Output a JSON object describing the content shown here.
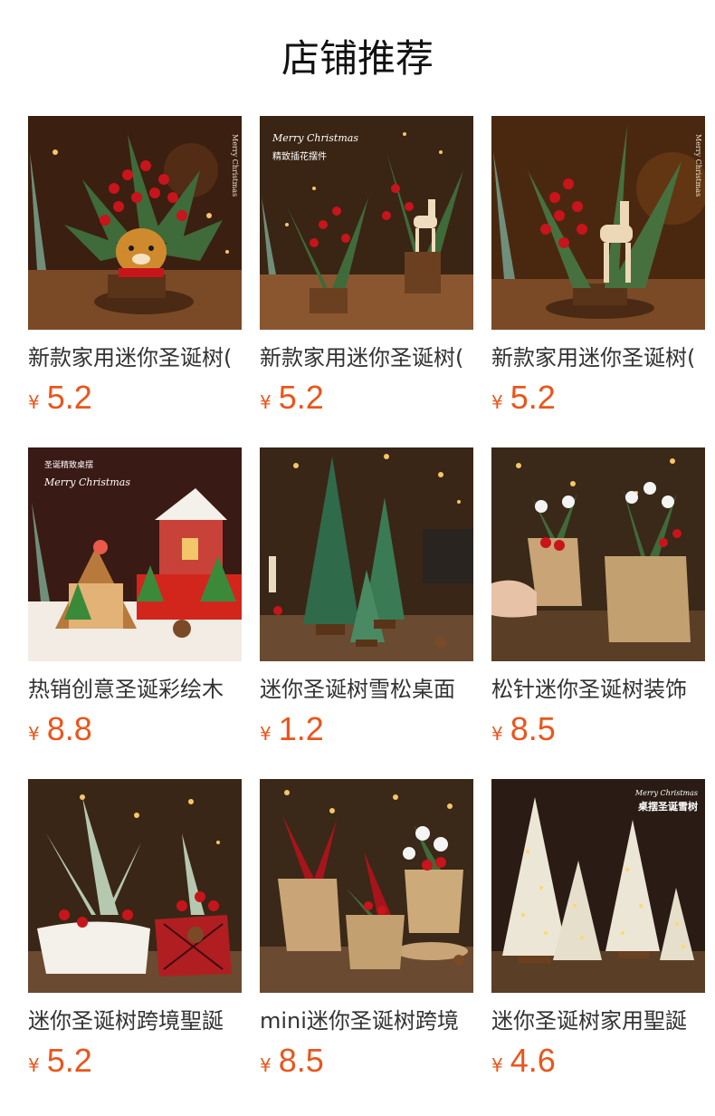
{
  "page": {
    "title": "店铺推荐"
  },
  "colors": {
    "price": "#e9561b",
    "text": "#333333",
    "title": "#111111",
    "background": "#ffffff"
  },
  "products": [
    {
      "name": "新款家用迷你圣诞树(",
      "currency": "¥",
      "price": "5.2",
      "image": "reindeer-plush-pine-arrangement",
      "image_text": [
        "Merry Christmas"
      ]
    },
    {
      "name": "新款家用迷你圣诞树(",
      "currency": "¥",
      "price": "5.2",
      "image": "wooden-reindeer-berry-arrangement",
      "image_text": [
        "Merry Christmas",
        "精致插花摆件"
      ]
    },
    {
      "name": "新款家用迷你圣诞树(",
      "currency": "¥",
      "price": "5.2",
      "image": "wooden-reindeer-pine-closeup",
      "image_text": [
        "Merry Christmas"
      ]
    },
    {
      "name": "热销创意圣诞彩绘木",
      "currency": "¥",
      "price": "8.8",
      "image": "painted-wooden-christmas-village",
      "image_text": [
        "圣诞精致桌摆",
        "Merry Christmas"
      ]
    },
    {
      "name": "迷你圣诞树雪松桌面",
      "currency": "¥",
      "price": "1.2",
      "image": "sisal-cedar-mini-trees",
      "image_text": []
    },
    {
      "name": "松针迷你圣诞树装饰",
      "currency": "¥",
      "price": "8.5",
      "image": "pine-needle-burlap-pots",
      "image_text": []
    },
    {
      "name": "迷你圣诞树跨境聖誕",
      "currency": "¥",
      "price": "5.2",
      "image": "snowy-pine-plaid-pots",
      "image_text": []
    },
    {
      "name": "mini迷你圣诞树跨境",
      "currency": "¥",
      "price": "8.5",
      "image": "burlap-potted-berry-arrangements",
      "image_text": []
    },
    {
      "name": "迷你圣诞树家用聖誕",
      "currency": "¥",
      "price": "4.6",
      "image": "flocked-led-mini-trees",
      "image_text": [
        "Merry Christmas",
        "桌摆圣诞雪树"
      ]
    }
  ]
}
